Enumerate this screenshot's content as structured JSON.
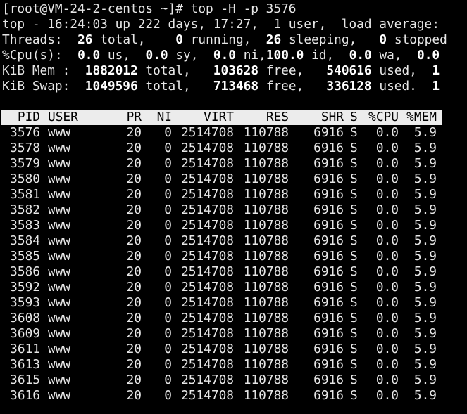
{
  "prompt": "[root@VM-24-2-centos ~]# top -H -p 3576",
  "summary": {
    "top_line": "top - 16:24:03 up 222 days, 17:27,  1 user,  load average:",
    "threads": {
      "label": "Threads:",
      "total": "26",
      "total_lbl": "total,",
      "running": "0",
      "running_lbl": "running,",
      "sleeping": "26",
      "sleeping_lbl": "sleeping,",
      "stopped": "0",
      "stopped_lbl": "stopped"
    },
    "cpu": {
      "label": "%Cpu(s):",
      "us": "0.0",
      "us_lbl": "us,",
      "sy": "0.0",
      "sy_lbl": "sy,",
      "ni": "0.0",
      "ni_lbl": "ni,",
      "id": "100.0",
      "id_lbl": "id,",
      "wa": "0.0",
      "wa_lbl": "wa,",
      "last": "0.0"
    },
    "mem": {
      "label": "KiB Mem :",
      "total": "1882012",
      "total_lbl": "total,",
      "free": "103628",
      "free_lbl": "free,",
      "used": "540616",
      "used_lbl": "used,",
      "trail": "1"
    },
    "swap": {
      "label": "KiB Swap:",
      "total": "1049596",
      "total_lbl": "total,",
      "free": "713468",
      "free_lbl": "free,",
      "used": "336128",
      "used_lbl": "used.",
      "trail": "1"
    }
  },
  "columns": [
    "PID",
    "USER",
    "PR",
    "NI",
    "VIRT",
    "RES",
    "SHR",
    "S",
    "%CPU",
    "%MEM"
  ],
  "rows": [
    [
      "3576",
      "www",
      "20",
      "0",
      "2514708",
      "110788",
      "6916",
      "S",
      "0.0",
      "5.9"
    ],
    [
      "3578",
      "www",
      "20",
      "0",
      "2514708",
      "110788",
      "6916",
      "S",
      "0.0",
      "5.9"
    ],
    [
      "3579",
      "www",
      "20",
      "0",
      "2514708",
      "110788",
      "6916",
      "S",
      "0.0",
      "5.9"
    ],
    [
      "3580",
      "www",
      "20",
      "0",
      "2514708",
      "110788",
      "6916",
      "S",
      "0.0",
      "5.9"
    ],
    [
      "3581",
      "www",
      "20",
      "0",
      "2514708",
      "110788",
      "6916",
      "S",
      "0.0",
      "5.9"
    ],
    [
      "3582",
      "www",
      "20",
      "0",
      "2514708",
      "110788",
      "6916",
      "S",
      "0.0",
      "5.9"
    ],
    [
      "3583",
      "www",
      "20",
      "0",
      "2514708",
      "110788",
      "6916",
      "S",
      "0.0",
      "5.9"
    ],
    [
      "3584",
      "www",
      "20",
      "0",
      "2514708",
      "110788",
      "6916",
      "S",
      "0.0",
      "5.9"
    ],
    [
      "3585",
      "www",
      "20",
      "0",
      "2514708",
      "110788",
      "6916",
      "S",
      "0.0",
      "5.9"
    ],
    [
      "3586",
      "www",
      "20",
      "0",
      "2514708",
      "110788",
      "6916",
      "S",
      "0.0",
      "5.9"
    ],
    [
      "3592",
      "www",
      "20",
      "0",
      "2514708",
      "110788",
      "6916",
      "S",
      "0.0",
      "5.9"
    ],
    [
      "3593",
      "www",
      "20",
      "0",
      "2514708",
      "110788",
      "6916",
      "S",
      "0.0",
      "5.9"
    ],
    [
      "3608",
      "www",
      "20",
      "0",
      "2514708",
      "110788",
      "6916",
      "S",
      "0.0",
      "5.9"
    ],
    [
      "3609",
      "www",
      "20",
      "0",
      "2514708",
      "110788",
      "6916",
      "S",
      "0.0",
      "5.9"
    ],
    [
      "3611",
      "www",
      "20",
      "0",
      "2514708",
      "110788",
      "6916",
      "S",
      "0.0",
      "5.9"
    ],
    [
      "3613",
      "www",
      "20",
      "0",
      "2514708",
      "110788",
      "6916",
      "S",
      "0.0",
      "5.9"
    ],
    [
      "3615",
      "www",
      "20",
      "0",
      "2514708",
      "110788",
      "6916",
      "S",
      "0.0",
      "5.9"
    ],
    [
      "3616",
      "www",
      "20",
      "0",
      "2514708",
      "110788",
      "6916",
      "S",
      "0.0",
      "5.9"
    ]
  ]
}
